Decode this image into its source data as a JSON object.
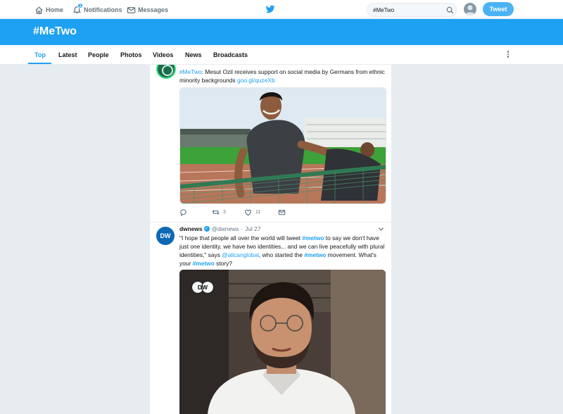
{
  "topbar": {
    "home_label": "Home",
    "notifications_label": "Notifications",
    "notifications_count": "1",
    "messages_label": "Messages",
    "search_value": "#MeTwo",
    "tweet_button_label": "Tweet"
  },
  "banner": {
    "title": "#MeTwo"
  },
  "tabs": [
    {
      "label": "Top",
      "active": true
    },
    {
      "label": "Latest"
    },
    {
      "label": "People"
    },
    {
      "label": "Photos"
    },
    {
      "label": "Videos"
    },
    {
      "label": "News"
    },
    {
      "label": "Broadcasts"
    }
  ],
  "tweet1": {
    "hashtag": "#MeTwo",
    "text": ": Mesut Ozil receives support on social media by Germans from ethnic minority backgrounds ",
    "link": "goo.gl/quzeXb",
    "retweets": "3",
    "likes": "11"
  },
  "tweet2": {
    "display_name": "dwnews",
    "verified_mark": "✓",
    "handle": "@dwnews",
    "separator": "·",
    "date": "Jul 27",
    "avatar_text": "DW",
    "text_parts": [
      "\"I hope that people all over the world will tweet ",
      "#metwo",
      " to say we don't have just one identity, we have two identities... and we can live peacefully with plural identities,\" says ",
      "@alicanglobal",
      ", who started the ",
      "#metwo",
      " movement. What's your ",
      "#metwo",
      " story?"
    ],
    "video_logo_text": "DW"
  },
  "colors": {
    "accent": "#1da1f2",
    "background": "#e6ecf0",
    "dw_blue": "#0c68b3"
  },
  "icons": [
    "home-icon",
    "bell-icon",
    "envelope-icon",
    "twitter-bird-icon",
    "search-icon",
    "reply-icon",
    "retweet-icon",
    "heart-icon",
    "direct-message-icon",
    "chevron-down-icon",
    "more-vertical-icon"
  ]
}
